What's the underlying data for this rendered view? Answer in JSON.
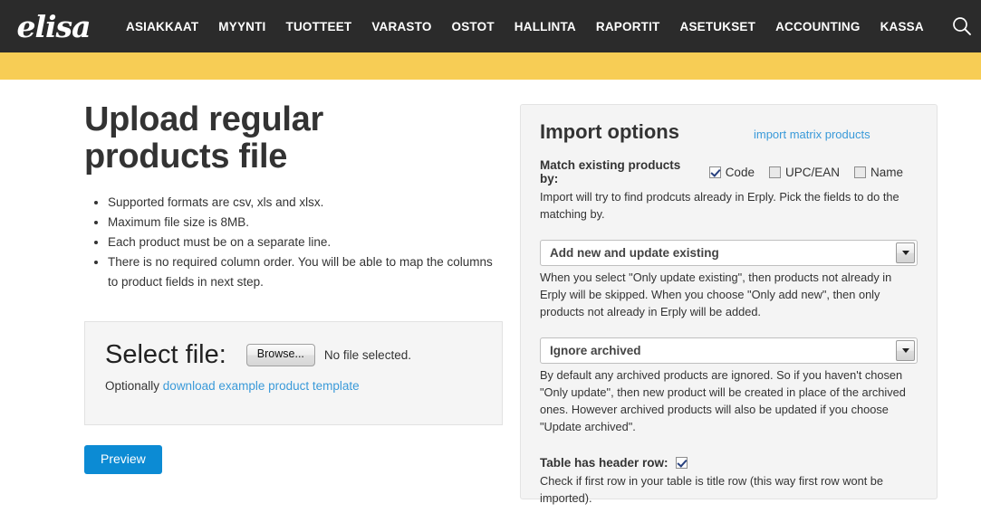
{
  "topnav": {
    "logo_text": "elisa",
    "items": [
      {
        "label": "ASIAKKAAT"
      },
      {
        "label": "MYYNTI"
      },
      {
        "label": "TUOTTEET"
      },
      {
        "label": "VARASTO"
      },
      {
        "label": "OSTOT"
      },
      {
        "label": "HALLINTA"
      },
      {
        "label": "RAPORTIT"
      },
      {
        "label": "ASETUKSET"
      },
      {
        "label": "ACCOUNTING"
      },
      {
        "label": "KASSA"
      }
    ],
    "search_icon": "search-icon",
    "bar_color": "#2b2b2b",
    "accent_bar_color": "#f7cd55"
  },
  "left": {
    "title": "Upload regular products file",
    "bullets": [
      "Supported formats are csv, xls and xlsx.",
      "Maximum file size is 8MB.",
      "Each product must be on a separate line.",
      "There is no required column order. You will be able to map the columns to product fields in next step."
    ],
    "file_box": {
      "select_file_label": "Select file:",
      "browse_button": "Browse...",
      "file_status": "No file selected.",
      "optionally_prefix": "Optionally ",
      "template_link": "download example product template"
    },
    "preview_button": "Preview",
    "preview_button_color": "#0c8bd4"
  },
  "import_options": {
    "title": "Import options",
    "matrix_link": "import matrix products",
    "match_label": "Match existing products by:",
    "match_checkboxes": [
      {
        "label": "Code",
        "checked": true
      },
      {
        "label": "UPC/EAN",
        "checked": false
      },
      {
        "label": "Name",
        "checked": false
      }
    ],
    "match_help": "Import will try to find prodcuts already in Erply. Pick the fields to do the matching by.",
    "mode_select": {
      "value": "Add new and update existing",
      "help": "When you select \"Only update existing\", then products not already in Erply will be skipped. When you choose \"Only add new\", then only products not already in Erply will be added."
    },
    "archived_select": {
      "value": "Ignore archived",
      "help": "By default any archived products are ignored. So if you haven't chosen \"Only update\", then new product will be created in place of the archived ones. However archived products will also be updated if you choose \"Update archived\"."
    },
    "header_row": {
      "label": "Table has header row:",
      "checked": true,
      "help": "Check if first row in your table is title row (this way first row wont be imported)."
    },
    "link_color": "#3a9ad9"
  }
}
